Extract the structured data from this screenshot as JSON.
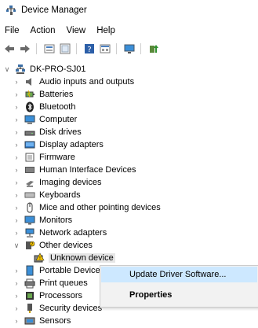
{
  "window": {
    "title": "Device Manager",
    "icon": "device-manager-icon"
  },
  "menu": [
    "File",
    "Action",
    "View",
    "Help"
  ],
  "toolbar": [
    "back-arrow-icon",
    "forward-arrow-icon",
    "properties-icon",
    "show-hidden-icon",
    "help-icon",
    "view-icon",
    "monitor-icon",
    "update-driver-icon"
  ],
  "tree": {
    "root": "DK-PRO-SJ01",
    "items": [
      {
        "label": "Audio inputs and outputs",
        "icon": "speaker-icon",
        "expanded": false
      },
      {
        "label": "Batteries",
        "icon": "battery-icon",
        "expanded": false
      },
      {
        "label": "Bluetooth",
        "icon": "bluetooth-icon",
        "expanded": false
      },
      {
        "label": "Computer",
        "icon": "computer-icon",
        "expanded": false
      },
      {
        "label": "Disk drives",
        "icon": "disk-icon",
        "expanded": false
      },
      {
        "label": "Display adapters",
        "icon": "display-adapter-icon",
        "expanded": false
      },
      {
        "label": "Firmware",
        "icon": "firmware-icon",
        "expanded": false
      },
      {
        "label": "Human Interface Devices",
        "icon": "hid-icon",
        "expanded": false
      },
      {
        "label": "Imaging devices",
        "icon": "camera-icon",
        "expanded": false
      },
      {
        "label": "Keyboards",
        "icon": "keyboard-icon",
        "expanded": false
      },
      {
        "label": "Mice and other pointing devices",
        "icon": "mouse-icon",
        "expanded": false
      },
      {
        "label": "Monitors",
        "icon": "monitor-icon",
        "expanded": false
      },
      {
        "label": "Network adapters",
        "icon": "network-icon",
        "expanded": false
      },
      {
        "label": "Other devices",
        "icon": "other-devices-icon",
        "expanded": true,
        "children": [
          {
            "label": "Unknown device",
            "icon": "unknown-device-icon",
            "selected": true
          }
        ]
      },
      {
        "label": "Portable Devices",
        "icon": "portable-device-icon",
        "expanded": false
      },
      {
        "label": "Print queues",
        "icon": "printer-icon",
        "expanded": false
      },
      {
        "label": "Processors",
        "icon": "processor-icon",
        "expanded": false
      },
      {
        "label": "Security devices",
        "icon": "security-icon",
        "expanded": false
      },
      {
        "label": "Sensors",
        "icon": "sensor-icon",
        "expanded": false
      }
    ]
  },
  "context_menu": {
    "items": [
      "Update Driver Software...",
      "Properties"
    ],
    "hovered": 0,
    "default": 1
  },
  "colors": {
    "hover": "#cde8ff",
    "selected": "#e6e6e6",
    "menu_bg": "#f2f2f2"
  }
}
